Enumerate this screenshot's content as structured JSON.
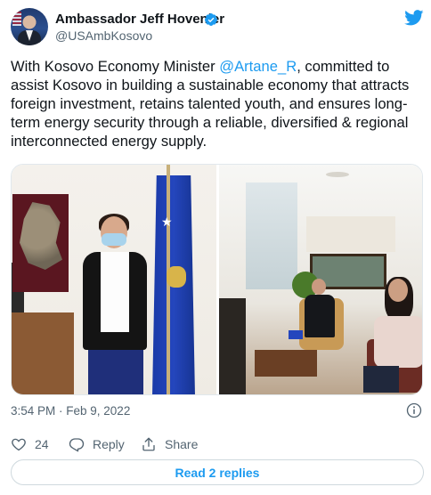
{
  "author": {
    "display_name": "Ambassador Jeff Hovenier",
    "handle": "@USAmbKosovo",
    "verified": true,
    "verified_icon": "verified-badge-icon",
    "avatar_icon": "profile-avatar"
  },
  "brand": {
    "logo_icon": "twitter-bird-icon",
    "accent_color": "#1d9bf0"
  },
  "tweet": {
    "text_before_mention": "With Kosovo Economy Minister ",
    "mention": "@Artane_R",
    "text_after_mention": ", committed to assist Kosovo in building a sustainable economy that attracts foreign investment, retains talented youth, and ensures long-term energy security through a reliable, diversified & regional interconnected energy supply."
  },
  "meta": {
    "timestamp": "3:54 PM · Feb 9, 2022",
    "info_icon": "info-icon"
  },
  "actions": {
    "like_count": "24",
    "like_icon": "heart-icon",
    "reply_label": "Reply",
    "reply_icon": "reply-icon",
    "share_label": "Share",
    "share_icon": "share-icon"
  },
  "read_replies_label": "Read 2 replies"
}
